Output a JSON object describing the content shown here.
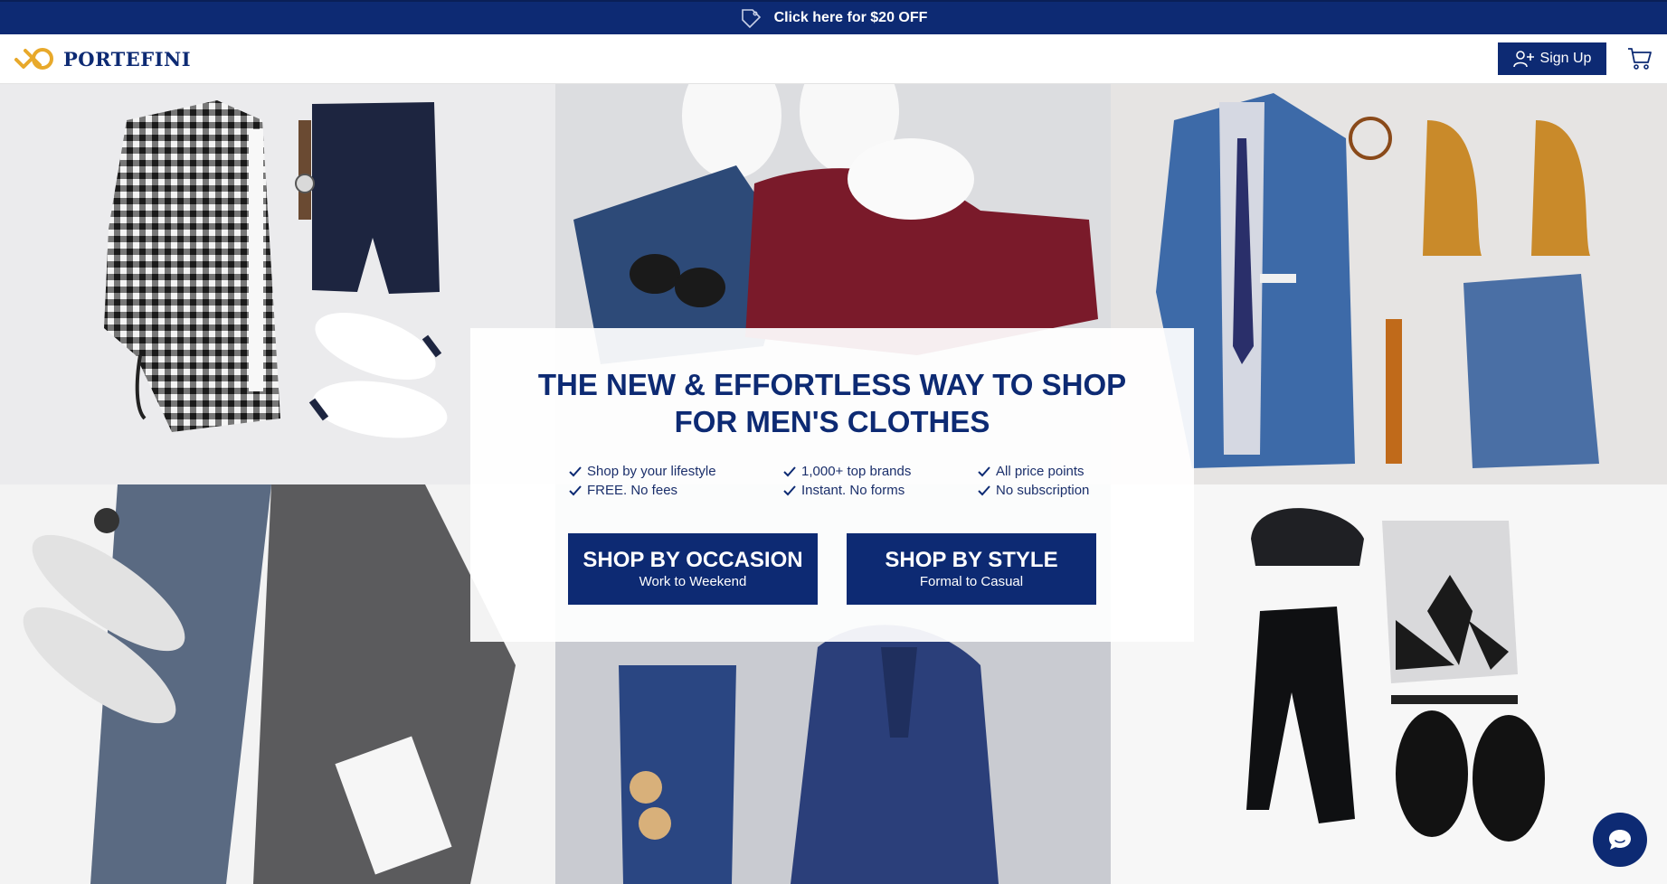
{
  "promo": {
    "text": "Click here for $20 OFF",
    "icon": "tag-icon"
  },
  "header": {
    "logo_text": "PORTEFINI",
    "signup_label": "Sign Up",
    "brand_color": "#0d2a73",
    "accent_color": "#e8a92b"
  },
  "hero": {
    "headline_line1": "THE NEW & EFFORTLESS WAY TO SHOP",
    "headline_line2": "FOR MEN'S CLOTHES",
    "features": [
      "Shop by your lifestyle",
      "1,000+ top brands",
      "All price points",
      "FREE. No fees",
      "Instant. No forms",
      "No subscription"
    ],
    "buttons": [
      {
        "title": "SHOP BY OCCASION",
        "subtitle": "Work to Weekend"
      },
      {
        "title": "SHOP BY STYLE",
        "subtitle": "Formal to Casual"
      }
    ]
  },
  "photo_tiles": [
    "outfit-gingham-shirt-jeans-sneakers",
    "outfit-burgundy-sweater-jeans-white-shoes",
    "outfit-blue-blazer-jeans-boots",
    "outfit-grey-sweater-jeans-sneakers",
    "outfit-navy-suit-trousers-sunglasses",
    "outfit-grey-tshirt-black-pants-cap-sneakers"
  ],
  "icons": {
    "user-add": "user-add-icon",
    "cart": "cart-icon",
    "check": "check-icon",
    "chat": "chat-icon"
  }
}
